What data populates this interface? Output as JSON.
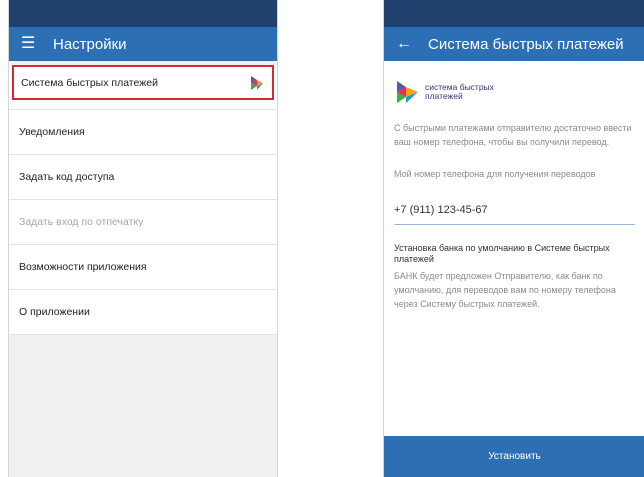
{
  "left": {
    "title": "Настройки",
    "menu": [
      {
        "label": "Система быстрых платежей"
      },
      {
        "label": "Уведомления"
      },
      {
        "label": "Задать код доступа"
      },
      {
        "label": "Задать вход по отпечатку"
      },
      {
        "label": "Возможности приложения"
      },
      {
        "label": "О приложении"
      }
    ]
  },
  "right": {
    "title": "Система быстрых платежей",
    "brand_line1": "система быстрых",
    "brand_line2": "платежей",
    "intro": "С быстрыми платежами отправителю достаточно ввести ваш номер телефона, чтобы вы получили перевод.",
    "phone_label": "Мой номер телефона для получения переводов",
    "phone_value": "+7 (911) 123-45-67",
    "default_bank_title": "Установка банка по умолчанию в Системе быстрых платежей",
    "default_bank_desc": "БАНК будет предложен Отправителю, как банк по умолчанию, для переводов вам по номеру телефона через Систему быстрых  платежей.",
    "install_button": "Установить"
  },
  "colors": {
    "statusbar": "#20416d",
    "appbar": "#2d6fb4",
    "highlight": "#d9282e"
  },
  "icons": {
    "menu": "hamburger-icon",
    "back": "back-arrow-icon",
    "sbp": "sbp-logo-icon"
  }
}
